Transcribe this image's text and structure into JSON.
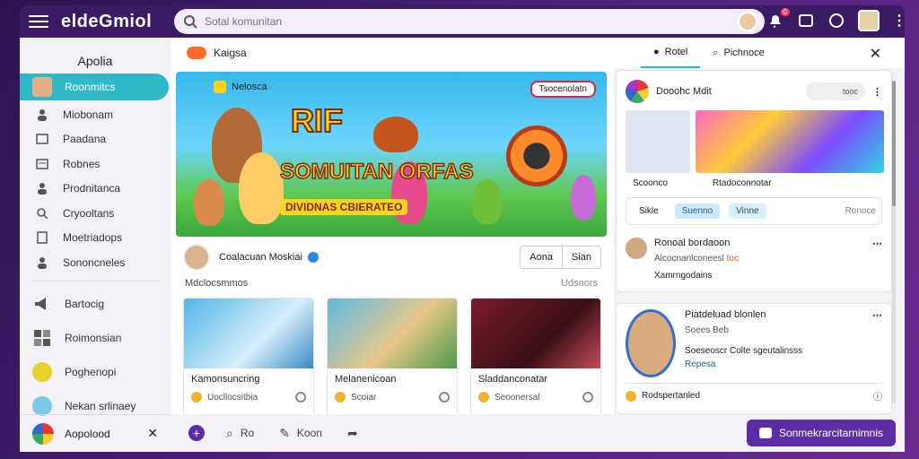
{
  "app": {
    "logo_text": "eldeGmiol",
    "search_placeholder": "Sotal komunitan",
    "notif_count": "0"
  },
  "sidebar": {
    "title": "Apolia",
    "items": [
      {
        "label": "Roonmitcs",
        "icon": "user-avatar-icon"
      },
      {
        "label": "Miobonam",
        "icon": "person-icon"
      },
      {
        "label": "Paadana",
        "icon": "image-icon"
      },
      {
        "label": "Robnes",
        "icon": "card-icon"
      },
      {
        "label": "Prodnitanca",
        "icon": "person-icon"
      },
      {
        "label": "Cryooltans",
        "icon": "search-icon"
      },
      {
        "label": "Moetriadops",
        "icon": "document-icon"
      },
      {
        "label": "Sononcneles",
        "icon": "person-icon"
      },
      {
        "label": "Bartocig",
        "icon": "megaphone-icon"
      },
      {
        "label": "Roimonsian",
        "icon": "grid-icon"
      },
      {
        "label": "Poghenopi",
        "icon": "smiley-icon"
      },
      {
        "label": "Nekan srlinaey",
        "icon": "globe-icon"
      }
    ],
    "footer_label": "Aopolood"
  },
  "main": {
    "header": "Kaigsa",
    "banner": {
      "chip_left": "Nelosca",
      "chip_right": "Tsocenolatn",
      "title_1": "RIF",
      "title_2": "SOMUITAN ORFAS",
      "title_3": "DIVIDNAS CBIERATEO"
    },
    "author_name": "Coalacuan Moskiai",
    "btn_a": "Aona",
    "btn_b": "Sian",
    "sub_left": "Mdclocsmmos",
    "sub_right": "Udsnors",
    "cards": [
      {
        "title": "Kamonsuncring",
        "foot": "Uocllocsitbia"
      },
      {
        "title": "Melanenicoan",
        "foot": "Scoiar"
      },
      {
        "title": "Sladdanconatar",
        "foot": "Seoonersal"
      }
    ]
  },
  "bottom": {
    "item_1": "Ro",
    "item_2": "Koon",
    "cta": "Sonmekrarcitarnimnis"
  },
  "right": {
    "tab_1": "Rotel",
    "tab_2": "Pichnoce",
    "post": {
      "name": "Dooohc Mdit",
      "pill": "tooc",
      "cap_1": "Scoonco",
      "cap_2": "Rtadoconnotar",
      "act_1": "Sikle",
      "act_2": "Suenno",
      "act_3": "Vinne",
      "act_end": "Ronoce"
    },
    "comment": {
      "name": "Ronoal bordaoon",
      "line_2a": "Alcocnanlconeesl",
      "line_2b": "toc",
      "line_3": "Xamrngodains"
    },
    "card2": {
      "name": "Piatdeluad blonlen",
      "line_1": "Soees Beb",
      "line_2": "Soeseoscr Colte sgeutalinsss",
      "line_3": "Repesa",
      "foot": "Rodspertanled"
    }
  }
}
